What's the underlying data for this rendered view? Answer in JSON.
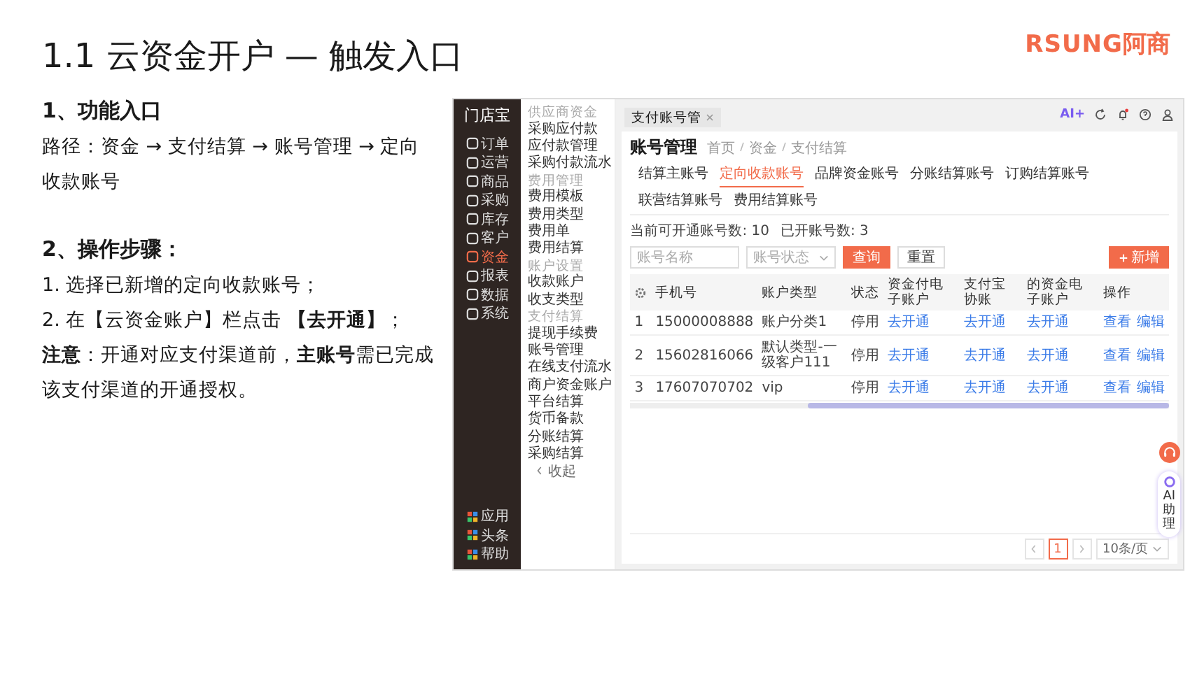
{
  "slide": {
    "title": "1.1 云资金开户 — 触发入口",
    "sections": [
      {
        "heading": "1、功能入口",
        "lines": [
          "路径：资金 → 支付结算 → 账号管理 → 定向收款账号"
        ]
      },
      {
        "heading": "2、操作步骤：",
        "lines": [
          "1. 选择已新增的定向收款账号；",
          "2. 在【云资金账户】栏点击 **【去开通】**；",
          "**注意**：开通对应支付渠道前，**主账号**需已完成该支付渠道的开通授权。"
        ]
      }
    ]
  },
  "logo": {
    "latin": "RSUNG",
    "cjk": "阿商"
  },
  "app": {
    "brand": "门店宝",
    "nav": [
      {
        "label": "订单",
        "selected": false
      },
      {
        "label": "运营",
        "selected": false
      },
      {
        "label": "商品",
        "selected": false
      },
      {
        "label": "采购",
        "selected": false
      },
      {
        "label": "库存",
        "selected": false
      },
      {
        "label": "客户",
        "selected": false
      },
      {
        "label": "资金",
        "selected": true
      },
      {
        "label": "报表",
        "selected": false
      },
      {
        "label": "数据",
        "selected": false
      },
      {
        "label": "系统",
        "selected": false
      }
    ],
    "nav_bottom": [
      "应用",
      "头条",
      "帮助"
    ],
    "subnav": [
      {
        "kind": "section",
        "label": "供应商资金"
      },
      {
        "kind": "item",
        "label": "采购应付款"
      },
      {
        "kind": "item",
        "label": "应付款管理"
      },
      {
        "kind": "item",
        "label": "采购付款流水"
      },
      {
        "kind": "section",
        "label": "费用管理"
      },
      {
        "kind": "item",
        "label": "费用模板"
      },
      {
        "kind": "item",
        "label": "费用类型"
      },
      {
        "kind": "item",
        "label": "费用单"
      },
      {
        "kind": "item",
        "label": "费用结算"
      },
      {
        "kind": "section",
        "label": "账户设置"
      },
      {
        "kind": "item",
        "label": "收款账户"
      },
      {
        "kind": "item",
        "label": "收支类型"
      },
      {
        "kind": "section",
        "label": "支付结算"
      },
      {
        "kind": "item",
        "label": "提现手续费"
      },
      {
        "kind": "item",
        "label": "账号管理"
      },
      {
        "kind": "item",
        "label": "在线支付流水"
      },
      {
        "kind": "item",
        "label": "商户资金账户"
      },
      {
        "kind": "item",
        "label": "平台结算"
      },
      {
        "kind": "item",
        "label": "货币备款"
      },
      {
        "kind": "item",
        "label": "分账结算"
      },
      {
        "kind": "item",
        "label": "采购结算"
      }
    ],
    "collapse": "收起",
    "page_tab": "支付账号管",
    "ai_badge": "AI+",
    "title": "账号管理",
    "breadcrumb": [
      "首页",
      "资金",
      "支付结算"
    ],
    "tabs": [
      {
        "label": "结算主账号",
        "selected": false
      },
      {
        "label": "定向收款账号",
        "selected": true
      },
      {
        "label": "品牌资金账号",
        "selected": false
      },
      {
        "label": "分账结算账号",
        "selected": false
      },
      {
        "label": "订购结算账号",
        "selected": false
      },
      {
        "label": "联营结算账号",
        "selected": false
      },
      {
        "label": "费用结算账号",
        "selected": false
      }
    ],
    "stats": [
      {
        "label": "当前可开通账号数:",
        "value": "10"
      },
      {
        "label": "已开账号数:",
        "value": "3"
      }
    ],
    "filters": {
      "search_placeholder": "账号名称",
      "status_placeholder": "账号状态",
      "query": "查询",
      "reset": "重置",
      "add": "新增"
    },
    "table": {
      "columns": [
        "手机号",
        "账户类型",
        "状态",
        "资金付电子账户",
        "支付宝协账",
        "的资金电子账户",
        "操作"
      ],
      "rows": [
        {
          "index": "1",
          "phone": "15000008888",
          "type": "账户分类1",
          "status": "停用",
          "links": [
            "去开通",
            "去开通",
            "去开通"
          ],
          "actions": [
            "查看",
            "编辑"
          ]
        },
        {
          "index": "2",
          "phone": "15602816066",
          "type": "默认类型-一级客户111",
          "status": "停用",
          "links": [
            "去开通",
            "去开通",
            "去开通"
          ],
          "actions": [
            "查看",
            "编辑"
          ]
        },
        {
          "index": "3",
          "phone": "17607070702",
          "type": "vip",
          "status": "停用",
          "links": [
            "去开通",
            "去开通",
            "去开通"
          ],
          "actions": [
            "查看",
            "编辑"
          ]
        }
      ]
    },
    "pagination": {
      "page": "1",
      "page_size": "10条/页"
    },
    "assistant": "AI助理"
  }
}
